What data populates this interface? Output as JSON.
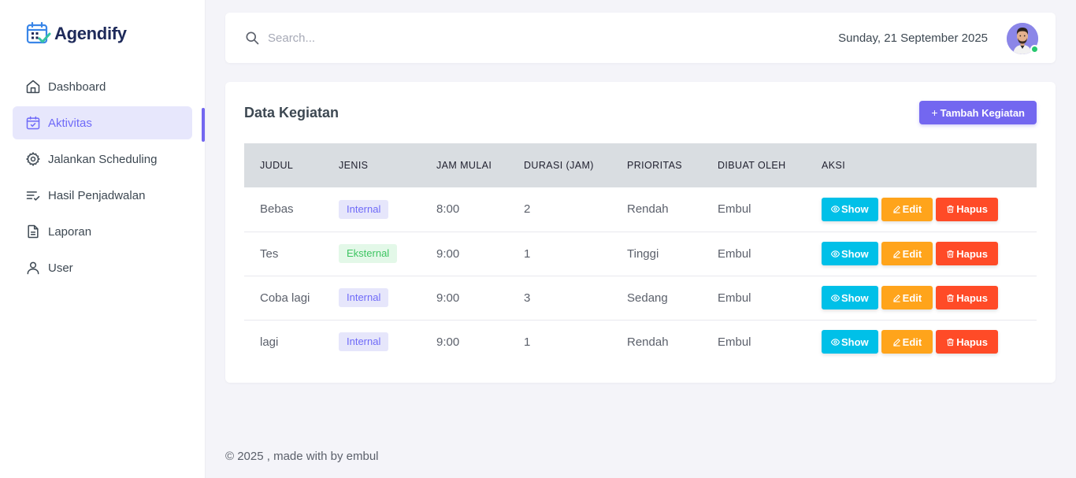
{
  "app": {
    "name": "Agendify"
  },
  "sidebar": {
    "items": [
      {
        "label": "Dashboard",
        "icon": "home-icon"
      },
      {
        "label": "Aktivitas",
        "icon": "calendar-check-icon",
        "active": true
      },
      {
        "label": "Jalankan Scheduling",
        "icon": "gear-icon"
      },
      {
        "label": "Hasil Penjadwalan",
        "icon": "list-check-icon"
      },
      {
        "label": "Laporan",
        "icon": "document-icon"
      },
      {
        "label": "User",
        "icon": "user-icon"
      }
    ]
  },
  "topbar": {
    "search_placeholder": "Search...",
    "date": "Sunday, 21 September 2025",
    "avatar_status_color": "#28c76f"
  },
  "card": {
    "title": "Data Kegiatan",
    "add_button": "Tambah Kegiatan",
    "columns": [
      "JUDUL",
      "JENIS",
      "JAM MULAI",
      "DURASI (JAM)",
      "PRIORITAS",
      "DIBUAT OLEH",
      "AKSI"
    ],
    "rows": [
      {
        "judul": "Bebas",
        "jenis": "Internal",
        "jam_mulai": "8:00",
        "durasi": "2",
        "prioritas": "Rendah",
        "dibuat_oleh": "Embul"
      },
      {
        "judul": "Tes",
        "jenis": "Eksternal",
        "jam_mulai": "9:00",
        "durasi": "1",
        "prioritas": "Tinggi",
        "dibuat_oleh": "Embul"
      },
      {
        "judul": "Coba lagi",
        "jenis": "Internal",
        "jam_mulai": "9:00",
        "durasi": "3",
        "prioritas": "Sedang",
        "dibuat_oleh": "Embul"
      },
      {
        "judul": "lagi",
        "jenis": "Internal",
        "jam_mulai": "9:00",
        "durasi": "1",
        "prioritas": "Rendah",
        "dibuat_oleh": "Embul"
      }
    ],
    "actions": {
      "show": "Show",
      "edit": "Edit",
      "hapus": "Hapus"
    }
  },
  "colors": {
    "accent": "#7367f0",
    "show": "#00c0e8",
    "edit": "#ffa41b",
    "hapus": "#ff4b27"
  },
  "footer": {
    "text": "© 2025 , made with by embul"
  }
}
